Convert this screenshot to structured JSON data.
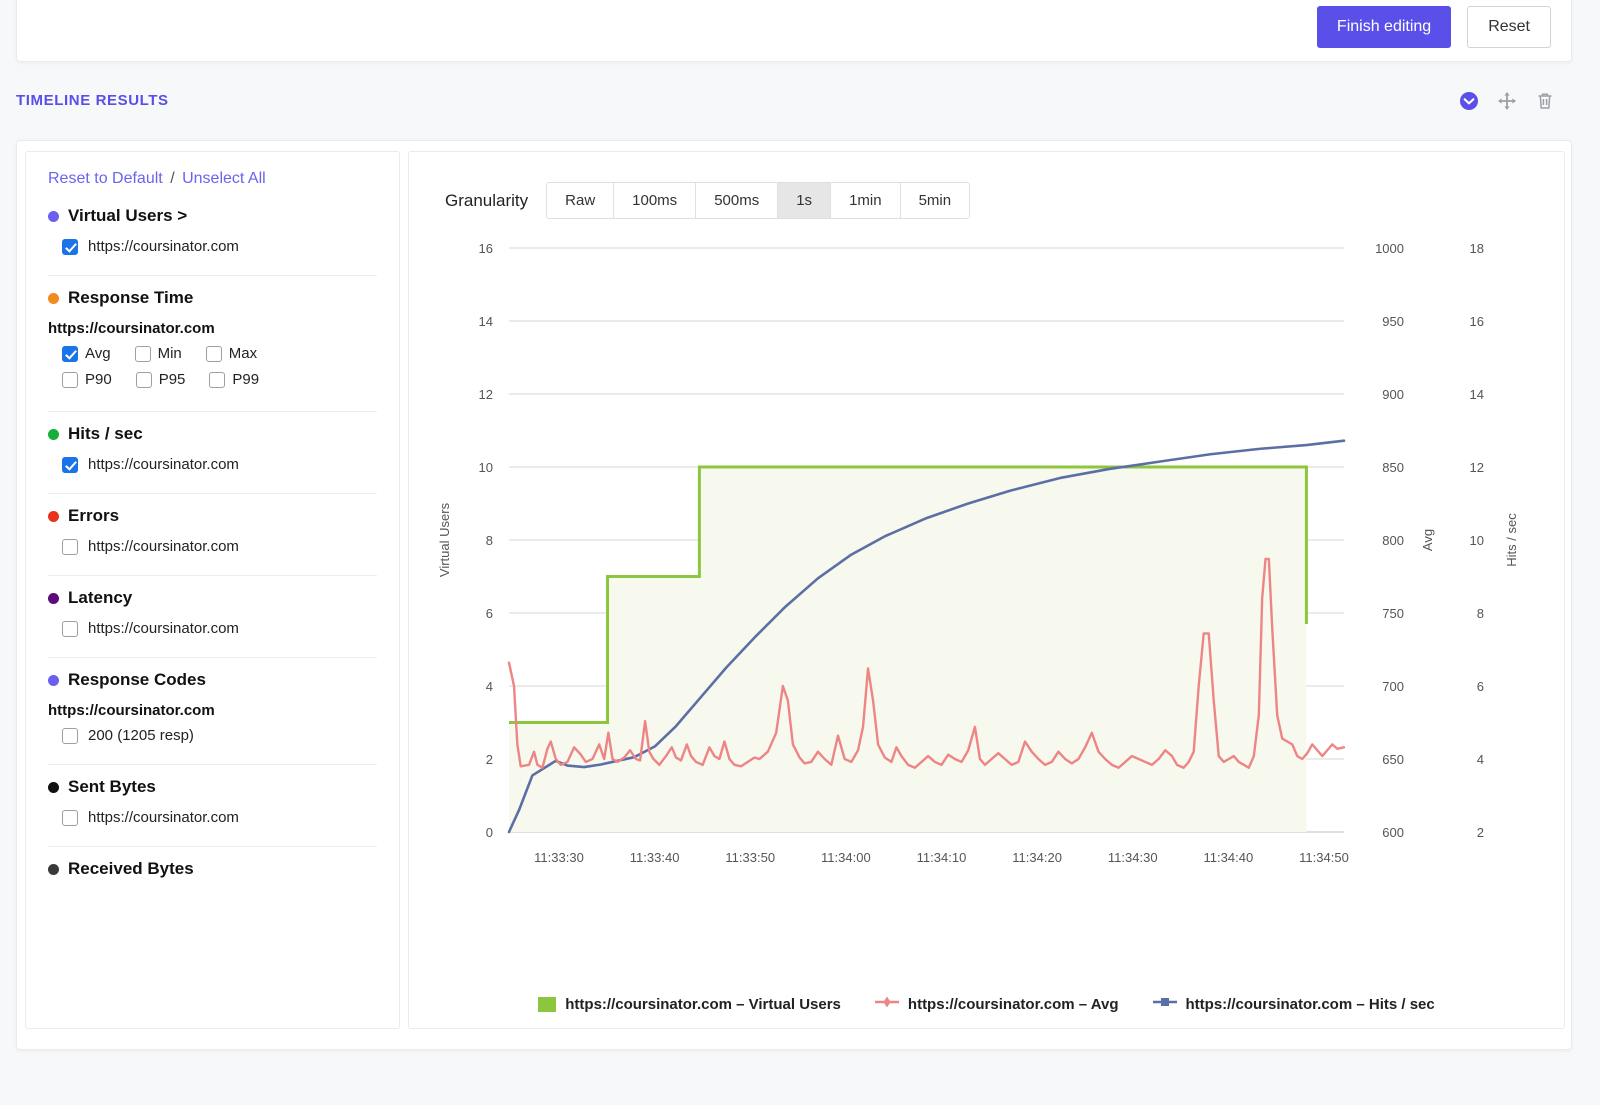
{
  "toolbar": {
    "finish_editing_label": "Finish editing",
    "reset_label": "Reset"
  },
  "section": {
    "title": "TIMELINE RESULTS",
    "icons": [
      "chevron-down-circle-icon",
      "move-icon",
      "trash-icon"
    ]
  },
  "sidebar": {
    "reset_to_default": "Reset to Default",
    "separator": "/",
    "unselect_all": "Unselect All",
    "groups": [
      {
        "title": "Virtual Users >",
        "color": "#6b5ef0",
        "items": [
          {
            "label": "https://coursinator.com",
            "checked": true
          }
        ]
      },
      {
        "title": "Response Time",
        "color": "#f28b1e",
        "host": "https://coursinator.com",
        "rows": [
          [
            {
              "label": "Avg",
              "checked": true
            },
            {
              "label": "Min",
              "checked": false
            },
            {
              "label": "Max",
              "checked": false
            }
          ],
          [
            {
              "label": "P90",
              "checked": false
            },
            {
              "label": "P95",
              "checked": false
            },
            {
              "label": "P99",
              "checked": false
            }
          ]
        ]
      },
      {
        "title": "Hits / sec",
        "color": "#17ae3a",
        "items": [
          {
            "label": "https://coursinator.com",
            "checked": true
          }
        ]
      },
      {
        "title": "Errors",
        "color": "#e8331c",
        "items": [
          {
            "label": "https://coursinator.com",
            "checked": false
          }
        ]
      },
      {
        "title": "Latency",
        "color": "#5c0a7a",
        "items": [
          {
            "label": "https://coursinator.com",
            "checked": false
          }
        ]
      },
      {
        "title": "Response Codes",
        "color": "#6b5ef0",
        "host": "https://coursinator.com",
        "items": [
          {
            "label": "200 (1205 resp)",
            "checked": false
          }
        ]
      },
      {
        "title": "Sent Bytes",
        "color": "#111111",
        "items": [
          {
            "label": "https://coursinator.com",
            "checked": false
          }
        ]
      },
      {
        "title": "Received Bytes",
        "color": "#3a3a3a",
        "items": []
      }
    ]
  },
  "granularity": {
    "label": "Granularity",
    "options": [
      "Raw",
      "100ms",
      "500ms",
      "1s",
      "1min",
      "5min"
    ],
    "selected": "1s"
  },
  "chart_data": {
    "type": "line",
    "title": "",
    "xlabel": "",
    "grid": true,
    "legend_position": "bottom",
    "x_tick_labels": [
      "11:33:30",
      "11:33:40",
      "11:33:50",
      "11:34:00",
      "11:34:10",
      "11:34:20",
      "11:34:30",
      "11:34:40",
      "11:34:50"
    ],
    "axes": [
      {
        "name": "Virtual Users",
        "side": "left",
        "ticks": [
          0,
          2,
          4,
          6,
          8,
          10,
          12,
          14,
          16
        ],
        "ylim": [
          0,
          16
        ]
      },
      {
        "name": "Avg",
        "side": "right",
        "ticks": [
          600,
          650,
          700,
          750,
          800,
          850,
          900,
          950,
          1000
        ],
        "ylim": [
          600,
          1000
        ]
      },
      {
        "name": "Hits / sec",
        "side": "right",
        "ticks": [
          2,
          4,
          6,
          8,
          10,
          12,
          14,
          16,
          18
        ],
        "ylim": [
          2,
          18
        ]
      }
    ],
    "series": [
      {
        "name": "https://coursinator.com – Virtual Users",
        "axis": "Virtual Users",
        "color": "#8cc63e",
        "fill": "#f6f8ee",
        "marker": "square",
        "style": "step",
        "values": [
          3,
          3,
          3,
          3,
          7,
          7,
          7,
          10,
          10,
          10,
          10,
          10,
          10,
          10,
          10,
          10,
          10,
          10,
          10,
          10,
          10,
          10,
          10,
          10,
          5.7
        ]
      },
      {
        "name": "https://coursinator.com – Avg",
        "axis": "Avg",
        "color": "#ee8585",
        "marker": "plus",
        "style": "line",
        "values": [
          715,
          648,
          652,
          655,
          648,
          662,
          644,
          652,
          660,
          650,
          656,
          648,
          652,
          662,
          670,
          652,
          648,
          656,
          690,
          655,
          648,
          652,
          660,
          652,
          648
        ]
      },
      {
        "name": "https://coursinator.com – Hits / sec",
        "axis": "Hits / sec",
        "color": "#5b6fa5",
        "marker": "plus-square",
        "style": "line",
        "values": [
          2.0,
          3.6,
          3.9,
          3.8,
          4.0,
          4.4,
          5.4,
          6.7,
          7.8,
          8.6,
          9.3,
          9.9,
          10.4,
          10.7,
          11.0,
          11.2,
          11.4,
          11.6,
          11.7,
          11.8,
          11.9,
          12.0,
          12.1,
          12.2,
          12.3
        ]
      }
    ],
    "legend_entries": [
      {
        "label": "https://coursinator.com – Virtual Users",
        "color": "#8cc63e",
        "marker": "square"
      },
      {
        "label": "https://coursinator.com – Avg",
        "color": "#ee8585",
        "marker": "plus"
      },
      {
        "label": "https://coursinator.com – Hits / sec",
        "color": "#5b6fa5",
        "marker": "plus-square"
      }
    ]
  }
}
